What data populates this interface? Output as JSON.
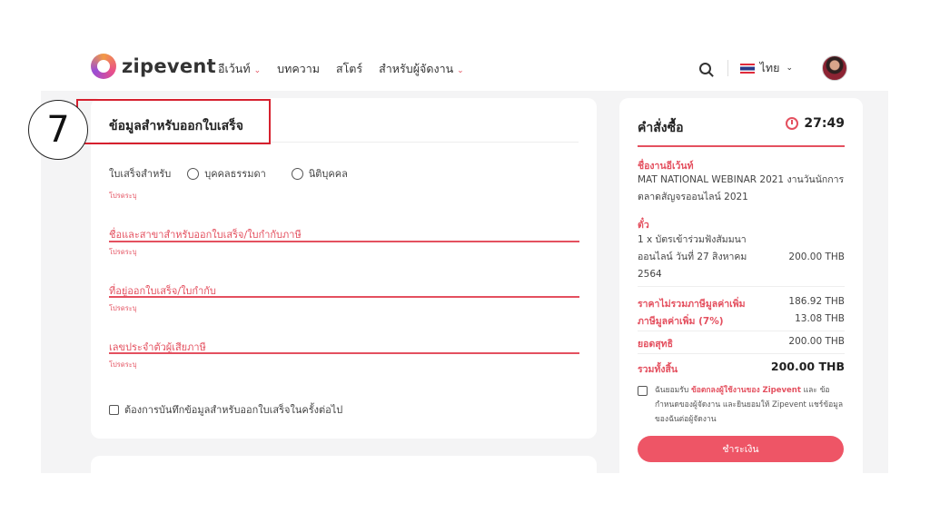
{
  "header": {
    "logo_text": "zipevent",
    "nav": [
      {
        "label": "อีเว้นท์",
        "has_dropdown": true
      },
      {
        "label": "บทความ",
        "has_dropdown": false
      },
      {
        "label": "สโตร์",
        "has_dropdown": false
      },
      {
        "label": "สำหรับผู้จัดงาน",
        "has_dropdown": true
      }
    ],
    "language": "ไทย"
  },
  "step_number": "7",
  "invoice_form": {
    "title": "ข้อมูลสำหรับออกใบเสร็จ",
    "invoice_for_label": "ใบเสร็จสำหรับ",
    "option_individual": "บุคคลธรรมดา",
    "option_company": "นิติบุคคล",
    "required_note": "โปรดระบุ",
    "fields": [
      {
        "label": "ชื่อและสาขาสำหรับออกใบเสร็จ/ใบกำกับภาษี",
        "note": "โปรดระบุ"
      },
      {
        "label": "ที่อยู่ออกใบเสร็จ/ใบกำกับ",
        "note": "โปรดระบุ"
      },
      {
        "label": "เลขประจำตัวผู้เสียภาษี",
        "note": "โปรดระบุ"
      }
    ],
    "save_checkbox_label": "ต้องการบันทึกข้อมูลสำหรับออกใบเสร็จในครั้งต่อไป"
  },
  "order": {
    "title": "คำสั่งซื้อ",
    "timer": "27:49",
    "event_label": "ชื่องานอีเว้นท์",
    "event_name_1": "MAT NATIONAL WEBINAR 2021 งานวันนักการ",
    "event_name_2": "ตลาดสัญจรออนไลน์ 2021",
    "ticket_label": "ตั๋ว",
    "ticket_line_1": "1 x บัตรเข้าร่วมฟังสัมมนา",
    "ticket_line_2": "ออนไลน์ วันที่ 27 สิงหาคม",
    "ticket_line_3": "2564",
    "ticket_price": "200.00 THB",
    "pre_vat_label": "ราคาไม่รวมภาษีมูลค่าเพิ่ม",
    "pre_vat_value": "186.92 THB",
    "vat_label": "ภาษีมูลค่าเพิ่ม (7%)",
    "vat_value": "13.08 THB",
    "net_label": "ยอดสุทธิ",
    "net_value": "200.00 THB",
    "total_label": "รวมทั้งสิ้น",
    "total_value": "200.00 THB",
    "terms_prefix": "ฉันยอมรับ",
    "terms_link": "ข้อตกลงผู้ใช้งานของ Zipevent",
    "terms_suffix": "และ ข้อกำหนดของผู้จัดงาน และยินยอมให้ Zipevent แชร์ข้อมูลของฉันต่อผู้จัดงาน",
    "pay_button": "ชำระเงิน"
  },
  "colors": {
    "accent": "#e4505f",
    "button": "#ee5566",
    "highlight": "#d6202e",
    "page_bg": "#f4f4f5"
  }
}
